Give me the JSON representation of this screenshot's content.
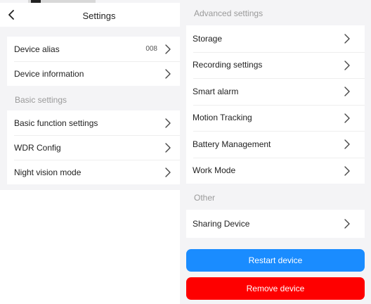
{
  "header": {
    "title": "Settings"
  },
  "left": {
    "general": [
      {
        "label": "Device alias",
        "value": "008"
      },
      {
        "label": "Device information",
        "value": ""
      }
    ],
    "basic_title": "Basic settings",
    "basic": [
      {
        "label": "Basic function settings"
      },
      {
        "label": "WDR Config"
      },
      {
        "label": "Night vision mode"
      }
    ]
  },
  "right": {
    "advanced_title": "Advanced settings",
    "advanced": [
      {
        "label": "Storage"
      },
      {
        "label": "Recording settings"
      },
      {
        "label": "Smart alarm"
      },
      {
        "label": "Motion Tracking"
      },
      {
        "label": "Battery Management"
      },
      {
        "label": "Work Mode"
      }
    ],
    "other_title": "Other",
    "other": [
      {
        "label": "Sharing Device"
      }
    ]
  },
  "buttons": {
    "restart": "Restart device",
    "remove": "Remove device"
  },
  "colors": {
    "restart": "#1a8cff",
    "remove": "#fe0000",
    "background": "#f4f4f6"
  },
  "icons": {
    "back": "back-arrow-icon",
    "chevron": "chevron-right-icon"
  }
}
